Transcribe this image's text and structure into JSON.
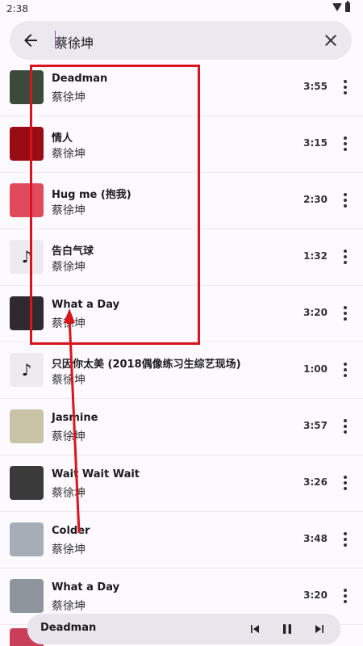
{
  "status": {
    "time": "2:38"
  },
  "search": {
    "query": "蔡徐坤"
  },
  "songs": [
    {
      "title": "Deadman",
      "artist": "蔡徐坤",
      "duration": "3:55",
      "thumb_color": "#3b4a3a"
    },
    {
      "title": "情人",
      "artist": "蔡徐坤",
      "duration": "3:15",
      "thumb_color": "#9a0c14"
    },
    {
      "title": "Hug me (抱我)",
      "artist": "蔡徐坤",
      "duration": "2:30",
      "thumb_color": "#e04a5c"
    },
    {
      "title": "告白气球",
      "artist": "蔡徐坤",
      "duration": "1:32",
      "thumb_color": "note"
    },
    {
      "title": "What a Day",
      "artist": "蔡徐坤",
      "duration": "3:20",
      "thumb_color": "#2e2a2f"
    },
    {
      "title": "只因你太美 (2018偶像练习生综艺现场)",
      "artist": "蔡徐坤",
      "duration": "1:00",
      "thumb_color": "note"
    },
    {
      "title": "Jasmine",
      "artist": "蔡徐坤",
      "duration": "3:57",
      "thumb_color": "#c9c4a8"
    },
    {
      "title": "Wait Wait Wait",
      "artist": "蔡徐坤",
      "duration": "3:26",
      "thumb_color": "#3a3a3a"
    },
    {
      "title": "Colder",
      "artist": "蔡徐坤",
      "duration": "3:48",
      "thumb_color": "#a5aeb6"
    },
    {
      "title": "What a Day",
      "artist": "蔡徐坤",
      "duration": "3:20",
      "thumb_color": "#8e969c"
    }
  ],
  "player": {
    "title": "Deadman"
  },
  "colors": {
    "accent": "#d9141c",
    "background": "#fcfaff"
  }
}
